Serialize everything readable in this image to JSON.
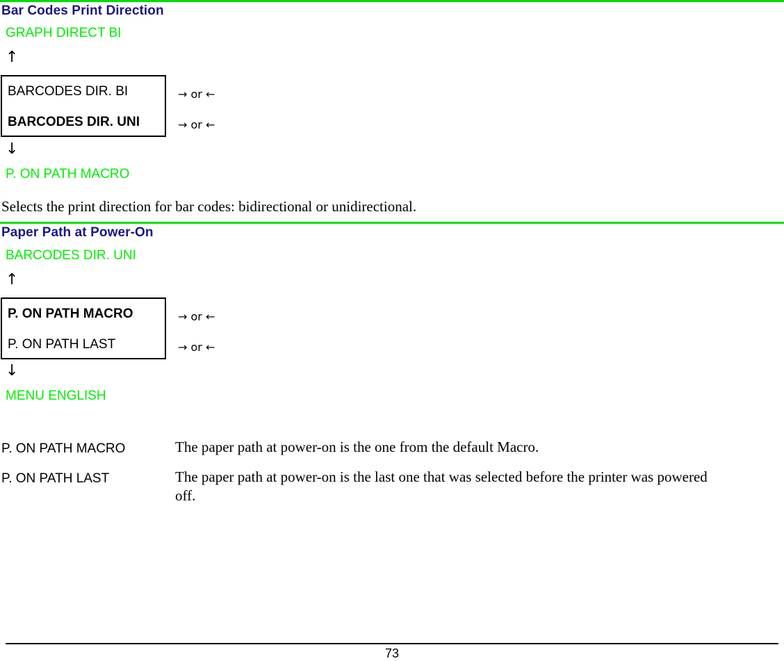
{
  "colors": {
    "heading_blue": "#181888",
    "menu_green": "#00ee00",
    "rule_green": "#00e000",
    "text_black": "#000000",
    "page_background": "#ffffff"
  },
  "sections": [
    {
      "heading": "Bar Codes Print Direction",
      "menu_above": "GRAPH DIRECT BI",
      "up_arrow": "↑",
      "down_arrow": "↓",
      "options": [
        {
          "label": "BARCODES DIR. BI",
          "bold": false,
          "hint": "→ or ←"
        },
        {
          "label": "BARCODES DIR. UNI",
          "bold": true,
          "hint": "→ or ←"
        }
      ],
      "menu_below": "P. ON PATH MACRO",
      "description": "Selects the print direction for bar codes: bidirectional or unidirectional."
    },
    {
      "heading": "Paper Path at Power-On",
      "menu_above": "BARCODES DIR. UNI",
      "up_arrow": "↑",
      "down_arrow": "↓",
      "options": [
        {
          "label": "P. ON  PATH MACRO",
          "bold": true,
          "hint": "→ or ←"
        },
        {
          "label": "P. ON  PATH LAST",
          "bold": false,
          "hint": "→ or ←"
        }
      ],
      "menu_below": "MENU ENGLISH"
    }
  ],
  "definitions": [
    {
      "term": "P. ON PATH MACRO",
      "description": "The paper path at power-on is the one from the default Macro."
    },
    {
      "term": "P. ON PATH LAST",
      "description": "The paper path at power-on is the last one that was selected before the printer was powered off."
    }
  ],
  "footer": {
    "page_number": "73"
  }
}
